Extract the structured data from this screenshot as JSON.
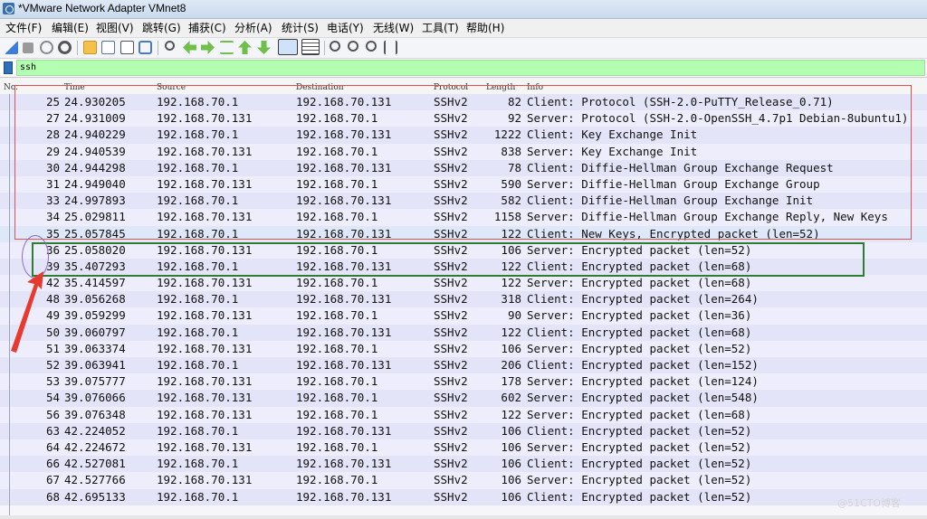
{
  "window": {
    "title": "*VMware Network Adapter VMnet8"
  },
  "menu": [
    "文件(F)",
    "编辑(E)",
    "视图(V)",
    "跳转(G)",
    "捕获(C)",
    "分析(A)",
    "统计(S)",
    "电话(Y)",
    "无线(W)",
    "工具(T)",
    "帮助(H)"
  ],
  "toolbar": {
    "icons": [
      "shark-fin-start-icon",
      "stop-icon",
      "restart-icon",
      "options-gear-icon",
      "open-folder-icon",
      "save-file-icon",
      "close-file-icon",
      "reload-icon",
      "find-packet-icon",
      "go-back-icon",
      "go-forward-icon",
      "go-to-packet-icon",
      "first-packet-icon",
      "last-packet-icon",
      "auto-scroll-icon",
      "colorize-icon",
      "zoom-in-icon",
      "zoom-out-icon",
      "normal-size-icon",
      "resize-columns-icon"
    ],
    "colors": {
      "bar": "#f3f5f8"
    }
  },
  "filter": {
    "value": "ssh",
    "color": "#b2ffb2"
  },
  "columns": {
    "no": "No.",
    "time": "Time",
    "source": "Source",
    "destination": "Destination",
    "protocol": "Protocol",
    "length": "Length",
    "info": "Info"
  },
  "packets": [
    {
      "no": "25",
      "time": "24.930205",
      "src": "192.168.70.1",
      "dst": "192.168.70.131",
      "proto": "SSHv2",
      "len": "82",
      "info": "Client: Protocol (SSH-2.0-PuTTY_Release_0.71)"
    },
    {
      "no": "27",
      "time": "24.931009",
      "src": "192.168.70.131",
      "dst": "192.168.70.1",
      "proto": "SSHv2",
      "len": "92",
      "info": "Server: Protocol (SSH-2.0-OpenSSH_4.7p1 Debian-8ubuntu1)"
    },
    {
      "no": "28",
      "time": "24.940229",
      "src": "192.168.70.1",
      "dst": "192.168.70.131",
      "proto": "SSHv2",
      "len": "1222",
      "info": "Client: Key Exchange Init"
    },
    {
      "no": "29",
      "time": "24.940539",
      "src": "192.168.70.131",
      "dst": "192.168.70.1",
      "proto": "SSHv2",
      "len": "838",
      "info": "Server: Key Exchange Init"
    },
    {
      "no": "30",
      "time": "24.944298",
      "src": "192.168.70.1",
      "dst": "192.168.70.131",
      "proto": "SSHv2",
      "len": "78",
      "info": "Client: Diffie-Hellman Group Exchange Request"
    },
    {
      "no": "31",
      "time": "24.949040",
      "src": "192.168.70.131",
      "dst": "192.168.70.1",
      "proto": "SSHv2",
      "len": "590",
      "info": "Server: Diffie-Hellman Group Exchange Group"
    },
    {
      "no": "33",
      "time": "24.997893",
      "src": "192.168.70.1",
      "dst": "192.168.70.131",
      "proto": "SSHv2",
      "len": "582",
      "info": "Client: Diffie-Hellman Group Exchange Init"
    },
    {
      "no": "34",
      "time": "25.029811",
      "src": "192.168.70.131",
      "dst": "192.168.70.1",
      "proto": "SSHv2",
      "len": "1158",
      "info": "Server: Diffie-Hellman Group Exchange Reply, New Keys"
    },
    {
      "no": "35",
      "time": "25.057845",
      "src": "192.168.70.1",
      "dst": "192.168.70.131",
      "proto": "SSHv2",
      "len": "122",
      "info": "Client: New Keys, Encrypted packet (len=52)"
    },
    {
      "no": "36",
      "time": "25.058020",
      "src": "192.168.70.131",
      "dst": "192.168.70.1",
      "proto": "SSHv2",
      "len": "106",
      "info": "Server: Encrypted packet (len=52)"
    },
    {
      "no": "39",
      "time": "35.407293",
      "src": "192.168.70.1",
      "dst": "192.168.70.131",
      "proto": "SSHv2",
      "len": "122",
      "info": "Client: Encrypted packet (len=68)"
    },
    {
      "no": "42",
      "time": "35.414597",
      "src": "192.168.70.131",
      "dst": "192.168.70.1",
      "proto": "SSHv2",
      "len": "122",
      "info": "Server: Encrypted packet (len=68)"
    },
    {
      "no": "48",
      "time": "39.056268",
      "src": "192.168.70.1",
      "dst": "192.168.70.131",
      "proto": "SSHv2",
      "len": "318",
      "info": "Client: Encrypted packet (len=264)"
    },
    {
      "no": "49",
      "time": "39.059299",
      "src": "192.168.70.131",
      "dst": "192.168.70.1",
      "proto": "SSHv2",
      "len": "90",
      "info": "Server: Encrypted packet (len=36)"
    },
    {
      "no": "50",
      "time": "39.060797",
      "src": "192.168.70.1",
      "dst": "192.168.70.131",
      "proto": "SSHv2",
      "len": "122",
      "info": "Client: Encrypted packet (len=68)"
    },
    {
      "no": "51",
      "time": "39.063374",
      "src": "192.168.70.131",
      "dst": "192.168.70.1",
      "proto": "SSHv2",
      "len": "106",
      "info": "Server: Encrypted packet (len=52)"
    },
    {
      "no": "52",
      "time": "39.063941",
      "src": "192.168.70.1",
      "dst": "192.168.70.131",
      "proto": "SSHv2",
      "len": "206",
      "info": "Client: Encrypted packet (len=152)"
    },
    {
      "no": "53",
      "time": "39.075777",
      "src": "192.168.70.131",
      "dst": "192.168.70.1",
      "proto": "SSHv2",
      "len": "178",
      "info": "Server: Encrypted packet (len=124)"
    },
    {
      "no": "54",
      "time": "39.076066",
      "src": "192.168.70.131",
      "dst": "192.168.70.1",
      "proto": "SSHv2",
      "len": "602",
      "info": "Server: Encrypted packet (len=548)"
    },
    {
      "no": "56",
      "time": "39.076348",
      "src": "192.168.70.131",
      "dst": "192.168.70.1",
      "proto": "SSHv2",
      "len": "122",
      "info": "Server: Encrypted packet (len=68)"
    },
    {
      "no": "63",
      "time": "42.224052",
      "src": "192.168.70.1",
      "dst": "192.168.70.131",
      "proto": "SSHv2",
      "len": "106",
      "info": "Client: Encrypted packet (len=52)"
    },
    {
      "no": "64",
      "time": "42.224672",
      "src": "192.168.70.131",
      "dst": "192.168.70.1",
      "proto": "SSHv2",
      "len": "106",
      "info": "Server: Encrypted packet (len=52)"
    },
    {
      "no": "66",
      "time": "42.527081",
      "src": "192.168.70.1",
      "dst": "192.168.70.131",
      "proto": "SSHv2",
      "len": "106",
      "info": "Client: Encrypted packet (len=52)"
    },
    {
      "no": "67",
      "time": "42.527766",
      "src": "192.168.70.131",
      "dst": "192.168.70.1",
      "proto": "SSHv2",
      "len": "106",
      "info": "Server: Encrypted packet (len=52)"
    },
    {
      "no": "68",
      "time": "42.695133",
      "src": "192.168.70.1",
      "dst": "192.168.70.131",
      "proto": "SSHv2",
      "len": "106",
      "info": "Client: Encrypted packet (len=52)"
    }
  ],
  "selected_packet": "35",
  "annotations": {
    "red_box_color": "#e05050",
    "green_box_color": "#2e7d32",
    "arrow_color": "#e8392f"
  },
  "watermark": "@51CTO博客"
}
